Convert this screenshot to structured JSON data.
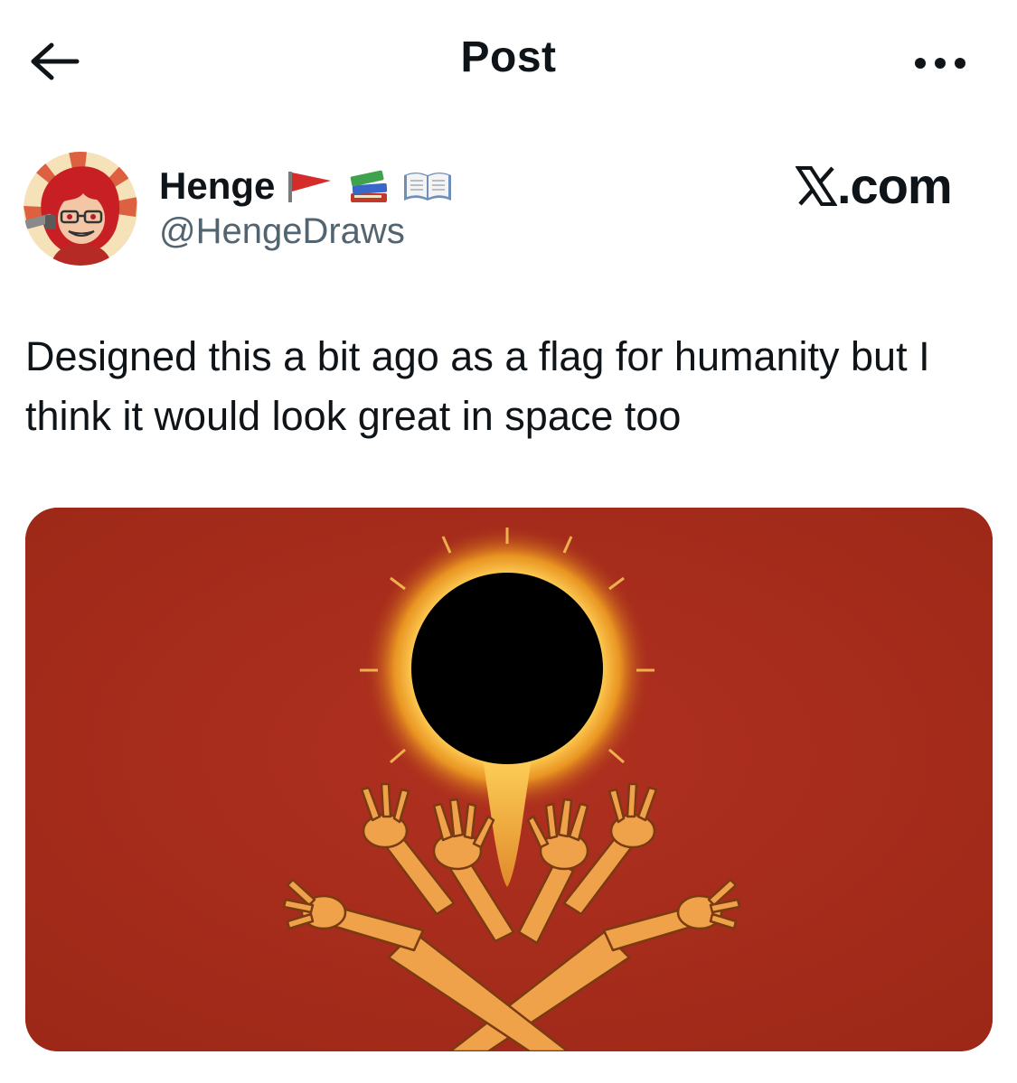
{
  "header": {
    "title": "Post",
    "back_icon": "back-arrow-icon",
    "more_icon": "more-horizontal-icon"
  },
  "author": {
    "display_name": "Henge",
    "handle": "@HengeDraws",
    "name_emojis": [
      "red-flag-icon",
      "books-icon",
      "open-book-icon"
    ]
  },
  "source_mark": {
    "logo_letter": "X",
    "suffix": ".com"
  },
  "post": {
    "text": "Designed this a bit ago as a flag for humanity but I think it would look great in space too"
  },
  "colors": {
    "text": "#0f1419",
    "secondary_text": "#536471",
    "flag_red": "#a32a1a",
    "hand_orange": "#f0a24a",
    "eclipse_black": "#000000"
  }
}
